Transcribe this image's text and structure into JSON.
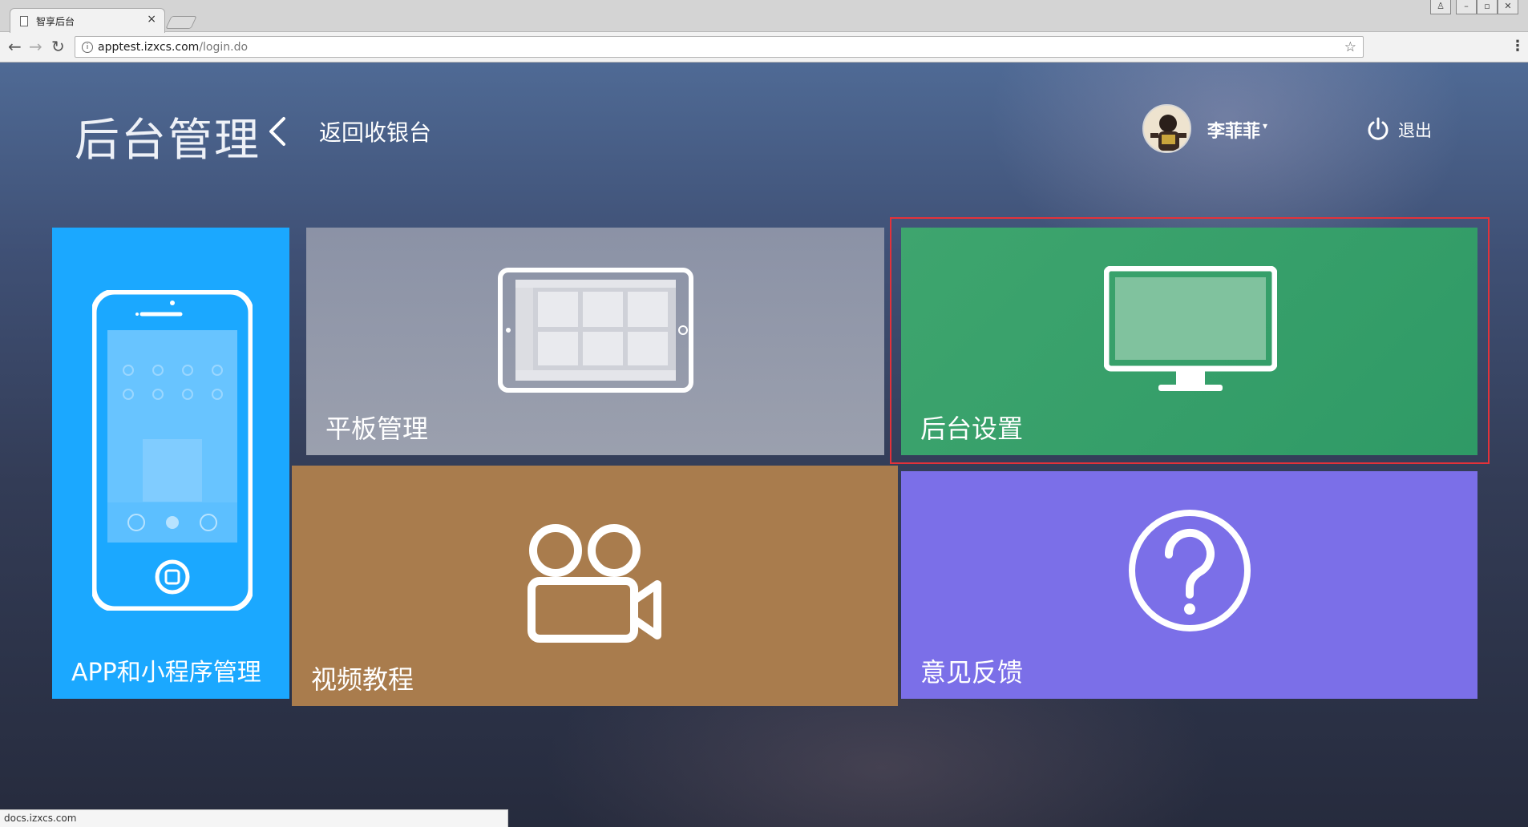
{
  "browser": {
    "tab_title": "智享后台",
    "tab_close": "×",
    "url_host": "apptest.izxcs.com",
    "url_path": "/login.do",
    "status_url": "docs.izxcs.com"
  },
  "header": {
    "app_title": "后台管理",
    "back_label": "返回收银台",
    "user_name": "李菲菲",
    "user_caret": "▾",
    "logout_label": "退出"
  },
  "tiles": [
    {
      "label": "APP和小程序管理",
      "color": "#1ba8ff",
      "icon": "phone-icon"
    },
    {
      "label": "平板管理",
      "color": "#9297a8",
      "icon": "tablet-icon"
    },
    {
      "label": "视频教程",
      "color": "#a97c4d",
      "icon": "video-camera-icon"
    },
    {
      "label": "后台设置",
      "color": "#3ea56e",
      "icon": "monitor-icon"
    },
    {
      "label": "意见反馈",
      "color": "#7b6fe8",
      "icon": "question-circle-icon"
    }
  ],
  "colors": {
    "highlight": "#e3323a"
  }
}
